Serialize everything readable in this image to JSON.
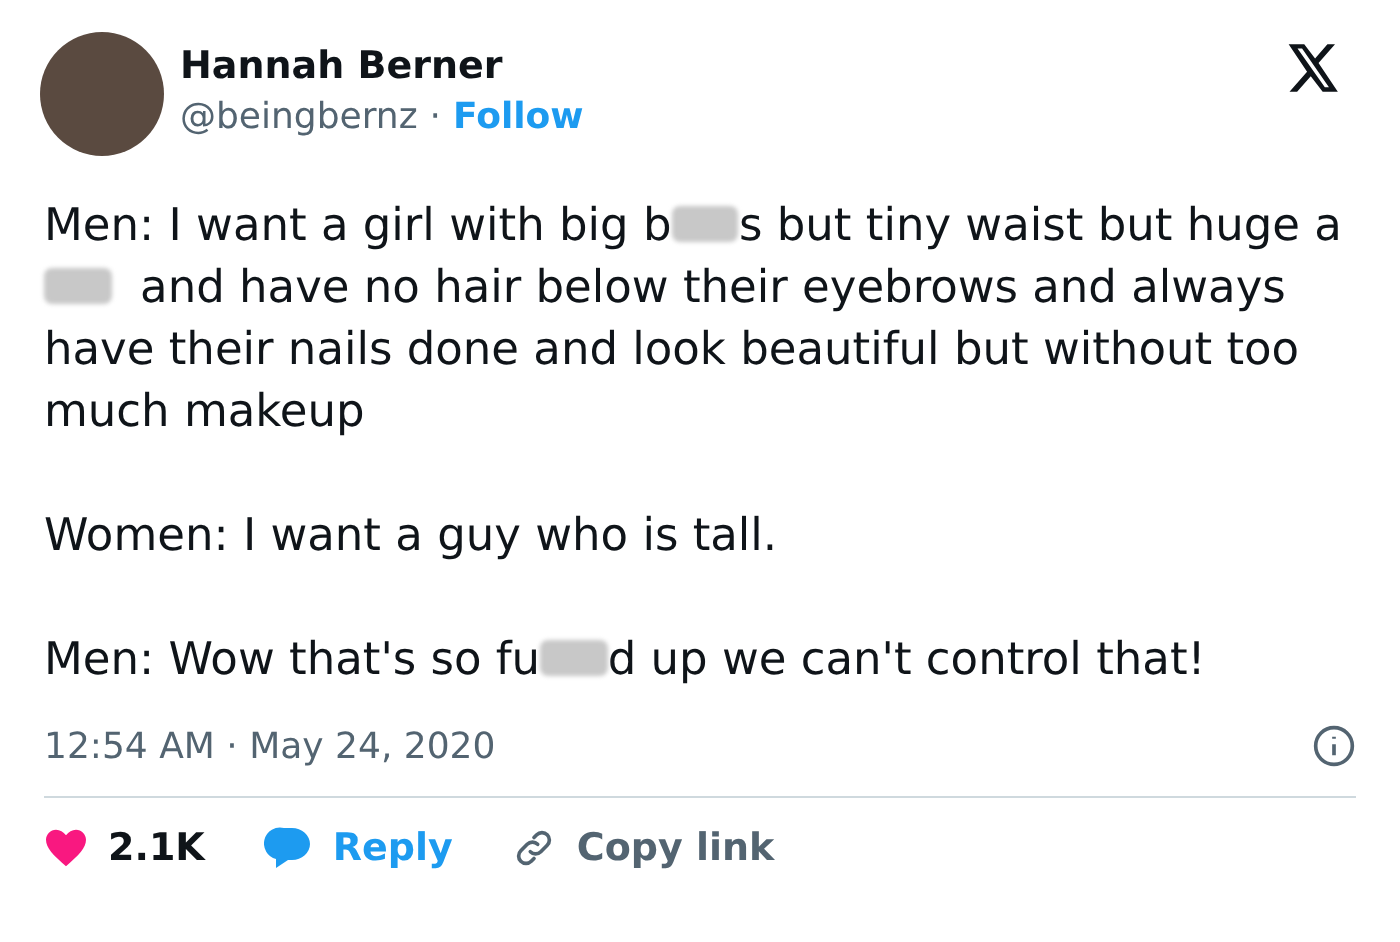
{
  "tweet": {
    "author": {
      "name": "Hannah Berner",
      "handle": "@beingbernz",
      "separator": "·",
      "follow": "Follow"
    },
    "paragraphs": [
      [
        {
          "kind": "text",
          "text": "Men: I want a girl with big b"
        },
        {
          "kind": "censor"
        },
        {
          "kind": "text",
          "text": "s but tiny waist but huge a"
        },
        {
          "kind": "censor"
        },
        {
          "kind": "text",
          "text": "  and have no hair below their eyebrows and always have their nails done and look beautiful but without too much makeup"
        }
      ],
      [
        {
          "kind": "text",
          "text": "Women: I want a guy who is tall."
        }
      ],
      [
        {
          "kind": "text",
          "text": "Men: Wow that's so fu"
        },
        {
          "kind": "censor"
        },
        {
          "kind": "text",
          "text": "d up we can't control that!"
        }
      ]
    ],
    "timestamp": "12:54 AM · May 24, 2020",
    "actions": [
      {
        "kind": "like",
        "label": "2.1K"
      },
      {
        "kind": "reply",
        "label": "Reply"
      },
      {
        "kind": "copy",
        "label": "Copy link"
      }
    ]
  }
}
